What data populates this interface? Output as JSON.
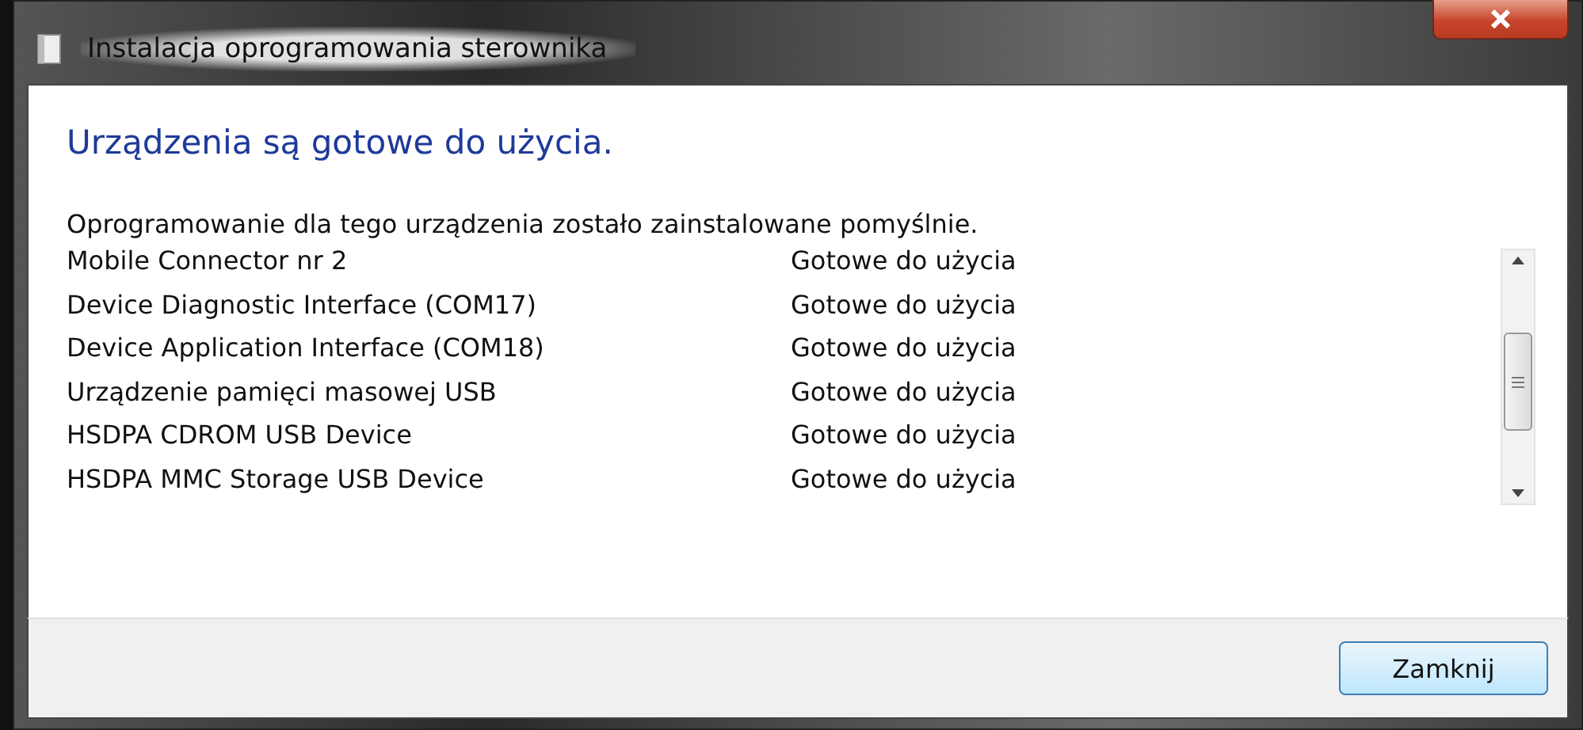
{
  "window": {
    "title": "Instalacja oprogramowania sterownika"
  },
  "heading": "Urządzenia są gotowe do użycia.",
  "message": "Oprogramowanie dla tego urządzenia zostało zainstalowane pomyślnie.",
  "devices": [
    {
      "name": "Mobile Connector nr 2",
      "status": "Gotowe do użycia"
    },
    {
      "name": "Device Diagnostic Interface (COM17)",
      "status": "Gotowe do użycia"
    },
    {
      "name": "Device Application Interface (COM18)",
      "status": "Gotowe do użycia"
    },
    {
      "name": "Urządzenie pamięci masowej USB",
      "status": "Gotowe do użycia"
    },
    {
      "name": "HSDPA CDROM USB Device",
      "status": "Gotowe do użycia"
    },
    {
      "name": "HSDPA MMC Storage USB Device",
      "status": "Gotowe do użycia"
    }
  ],
  "buttons": [
    "Zamknij"
  ]
}
